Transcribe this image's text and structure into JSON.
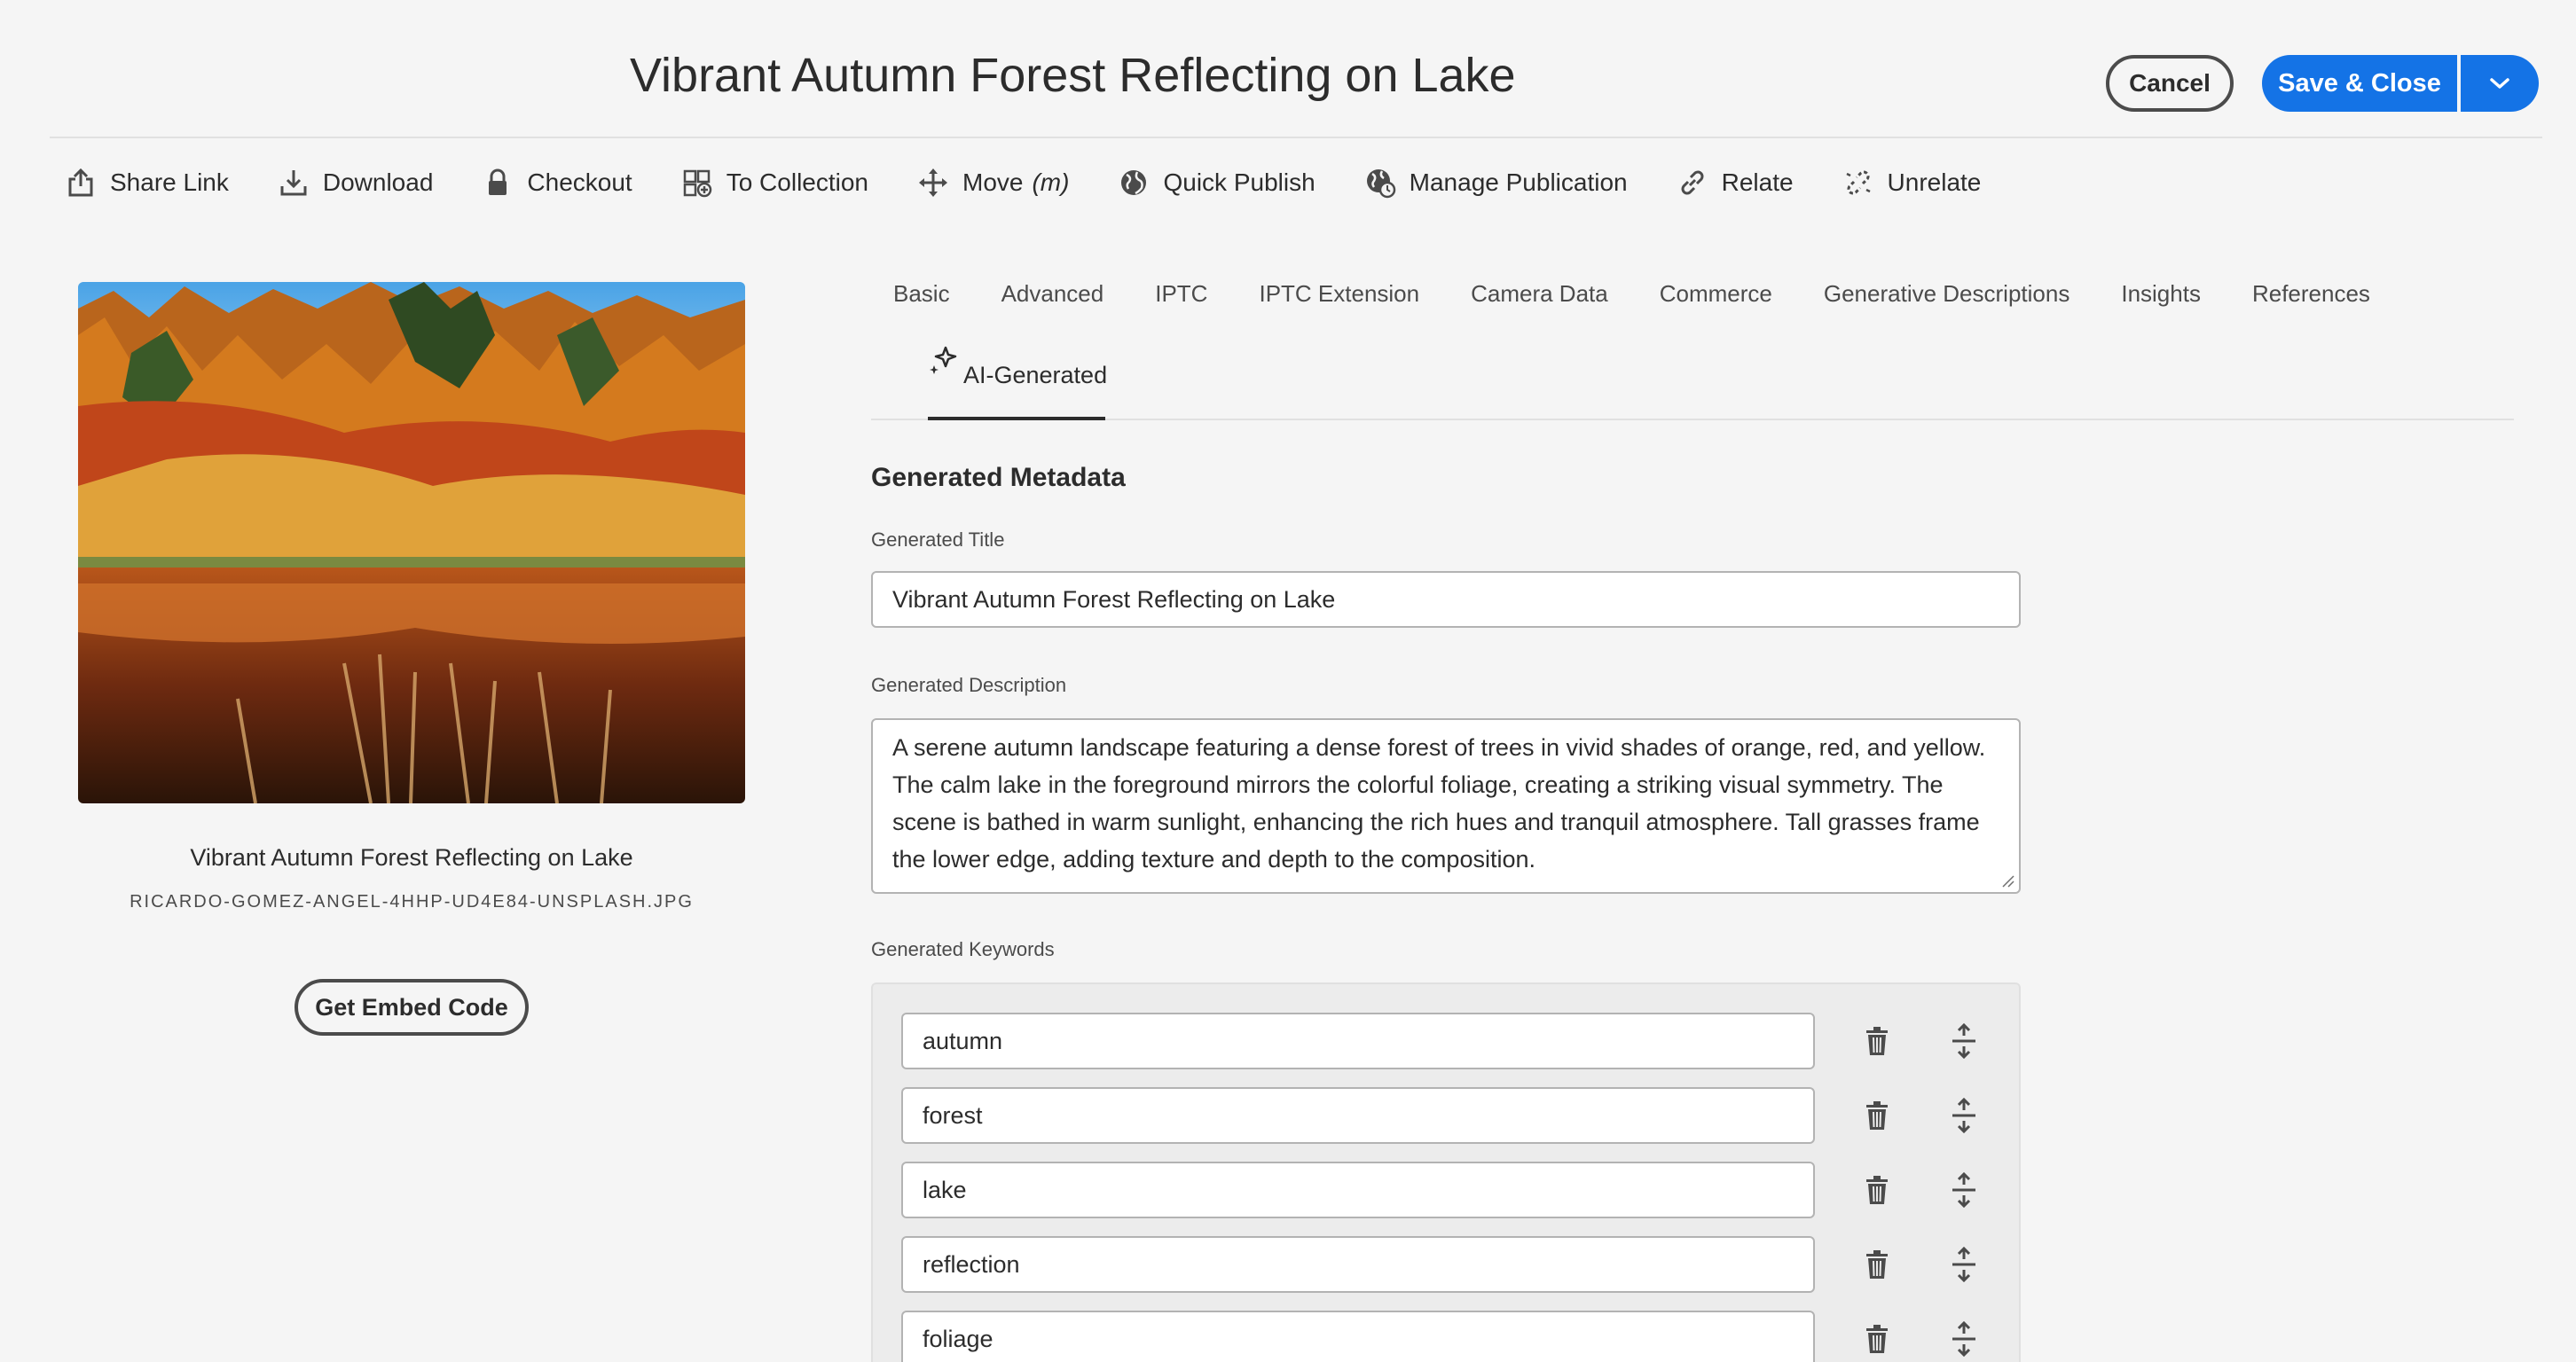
{
  "header": {
    "title": "Vibrant Autumn Forest Reflecting on Lake",
    "cancel_label": "Cancel",
    "save_label": "Save & Close"
  },
  "toolbar": {
    "items": [
      {
        "label": "Share Link",
        "icon": "share-icon"
      },
      {
        "label": "Download",
        "icon": "download-icon"
      },
      {
        "label": "Checkout",
        "icon": "lock-icon"
      },
      {
        "label": "To Collection",
        "icon": "add-to-collection-icon"
      },
      {
        "label": "Move",
        "hint": "(m)",
        "icon": "move-icon"
      },
      {
        "label": "Quick Publish",
        "icon": "globe-icon"
      },
      {
        "label": "Manage Publication",
        "icon": "globe-clock-icon"
      },
      {
        "label": "Relate",
        "icon": "link-icon"
      },
      {
        "label": "Unrelate",
        "icon": "unlink-icon"
      }
    ]
  },
  "asset": {
    "title": "Vibrant Autumn Forest Reflecting on Lake",
    "filename": "RICARDO-GOMEZ-ANGEL-4HHP-UD4E84-UNSPLASH.JPG",
    "embed_label": "Get Embed Code"
  },
  "tabs": {
    "items": [
      "Basic",
      "Advanced",
      "IPTC",
      "IPTC Extension",
      "Camera Data",
      "Commerce",
      "Generative Descriptions",
      "Insights",
      "References"
    ],
    "active": "AI-Generated"
  },
  "form": {
    "section_title": "Generated Metadata",
    "title_label": "Generated Title",
    "title_value": "Vibrant Autumn Forest Reflecting on Lake",
    "description_label": "Generated Description",
    "description_value": "A serene autumn landscape featuring a dense forest of trees in vivid shades of orange, red, and yellow. The calm lake in the foreground mirrors the colorful foliage, creating a striking visual symmetry. The scene is bathed in warm sunlight, enhancing the rich hues and tranquil atmosphere. Tall grasses frame the lower edge, adding texture and depth to the composition.",
    "keywords_label": "Generated Keywords",
    "keywords": [
      "autumn",
      "forest",
      "lake",
      "reflection",
      "foliage"
    ]
  },
  "colors": {
    "accent": "#1473e6",
    "background": "#f5f5f5",
    "text": "#2c2c2c"
  }
}
